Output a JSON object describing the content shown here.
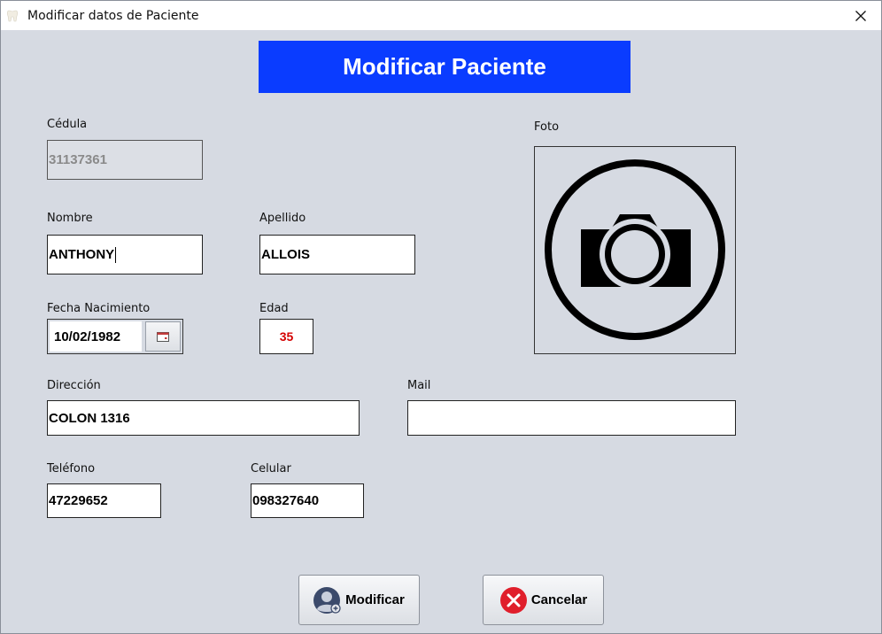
{
  "window": {
    "title": "Modificar datos de Paciente"
  },
  "header": {
    "title": "Modificar Paciente"
  },
  "form": {
    "cedula": {
      "label": "Cédula",
      "value": "31137361"
    },
    "nombre": {
      "label": "Nombre",
      "value": "ANTHONY"
    },
    "apellido": {
      "label": "Apellido",
      "value": "ALLOIS"
    },
    "fecha_nacimiento": {
      "label": "Fecha Nacimiento",
      "value": "10/02/1982"
    },
    "edad": {
      "label": "Edad",
      "value": "35"
    },
    "direccion": {
      "label": "Dirección",
      "value": "COLON 1316"
    },
    "mail": {
      "label": "Mail",
      "value": ""
    },
    "telefono": {
      "label": "Teléfono",
      "value": "47229652"
    },
    "celular": {
      "label": "Celular",
      "value": "098327640"
    }
  },
  "photo": {
    "label": "Foto",
    "icon": "camera-icon"
  },
  "buttons": {
    "modificar": "Modificar",
    "cancelar": "Cancelar"
  },
  "colors": {
    "banner": "#0a3cff",
    "edad_text": "#d40000",
    "cancel_icon": "#e01e2b",
    "background": "#d6dae2"
  }
}
